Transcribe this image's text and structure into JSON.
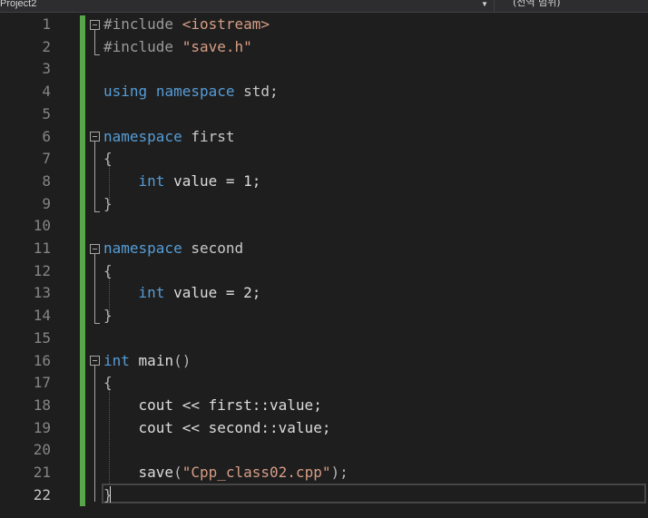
{
  "navbar": {
    "project": "Project2",
    "scope": "(전역 범위)"
  },
  "editor": {
    "current_line": 22,
    "line_numbers": [
      "1",
      "2",
      "3",
      "4",
      "5",
      "6",
      "7",
      "8",
      "9",
      "10",
      "11",
      "12",
      "13",
      "14",
      "15",
      "16",
      "17",
      "18",
      "19",
      "20",
      "21",
      "22"
    ],
    "code": {
      "l1_directive": "#include",
      "l1_header": "<iostream>",
      "l2_directive": "#include",
      "l2_header": "\"save.h\"",
      "l4_kw1": "using",
      "l4_kw2": "namespace",
      "l4_name": "std;",
      "l6_kw": "namespace",
      "l6_name": "first",
      "l7": "{",
      "l8_type": "int",
      "l8_rest": "value = 1;",
      "l9": "}",
      "l11_kw": "namespace",
      "l11_name": "second",
      "l12": "{",
      "l13_type": "int",
      "l13_rest": "value = 2;",
      "l14": "}",
      "l16_type": "int",
      "l16_fn": "main",
      "l16_parens": "()",
      "l17": "{",
      "l18": "cout << first::value;",
      "l19": "cout << second::value;",
      "l21_fn": "save",
      "l21_open": "(",
      "l21_str": "\"Cpp_class02.cpp\"",
      "l21_close": ");",
      "l22": "}"
    }
  },
  "colors": {
    "background": "#1e1e1e",
    "keyword": "#569cd6",
    "string": "#d69d85",
    "change_bar": "#57a64a",
    "line_number": "#858585"
  }
}
